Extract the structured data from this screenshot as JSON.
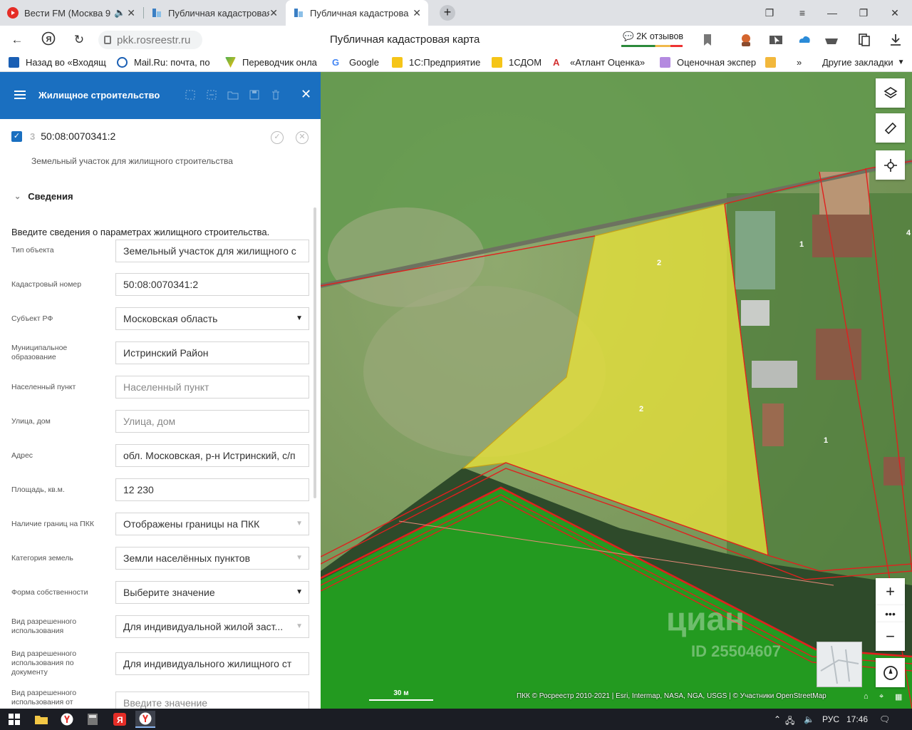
{
  "browser": {
    "tabs": [
      {
        "label": "Вести FM (Москва 9",
        "active": false
      },
      {
        "label": "Публичная кадастровая к",
        "active": false
      },
      {
        "label": "Публичная кадастрова",
        "active": true
      }
    ],
    "url": "pkk.rosreestr.ru",
    "page_title": "Публичная кадастровая карта",
    "reviews": "2K отзывов",
    "bookmarks": [
      "Назад во «Входящ",
      "Mail.Ru: почта, по",
      "Переводчик онла",
      "Google",
      "1С:Предприятие",
      "1СДОМ",
      "«Атлант Оценка»",
      "Оценочная экспер"
    ],
    "other_bookmarks": "Другие закладки"
  },
  "panel": {
    "title": "Жилищное строительство",
    "object_number": "3",
    "cadastral_number": "50:08:0070341:2",
    "object_subtitle": "Земельный участок для жилищного строительства",
    "section_title": "Сведения",
    "intro": "Введите сведения о параметрах жилищного строительства.",
    "fields": [
      {
        "label": "Тип объекта",
        "value": "Земельный участок для жилищного с",
        "kind": "text"
      },
      {
        "label": "Кадастровый номер",
        "value": "50:08:0070341:2",
        "kind": "text"
      },
      {
        "label": "Субъект РФ",
        "value": "Московская область",
        "kind": "select"
      },
      {
        "label": "Муниципальное образование",
        "value": "Истринский Район",
        "kind": "text"
      },
      {
        "label": "Населенный пункт",
        "placeholder": "Населенный пункт",
        "kind": "placeholder"
      },
      {
        "label": "Улица, дом",
        "placeholder": "Улица, дом",
        "kind": "placeholder"
      },
      {
        "label": "Адрес",
        "value": "обл. Московская, р-н Истринский, с/п",
        "kind": "text"
      },
      {
        "label": "Площадь, кв.м.",
        "value": "12 230",
        "kind": "text"
      },
      {
        "label": "Наличие границ на ПКК",
        "value": "Отображены границы на ПКК",
        "kind": "select-disabled"
      },
      {
        "label": "Категория земель",
        "value": "Земли населённых пунктов",
        "kind": "select-disabled"
      },
      {
        "label": "Форма собственности",
        "value": "Выберите значение",
        "kind": "select"
      },
      {
        "label": "Вид разрешенного использования",
        "value": "Для индивидуальной жилой заст...",
        "kind": "select-disabled"
      },
      {
        "label": "Вид разрешенного использования по документу",
        "value": "Для индивидуального жилищного ст",
        "kind": "text"
      },
      {
        "label": "Вид разрешенного использования от",
        "placeholder": "Введите значение",
        "kind": "placeholder"
      }
    ]
  },
  "map": {
    "parcel_labels": [
      "2",
      "2",
      "1",
      "1",
      "4"
    ],
    "scale": "30 м",
    "attribution": "ПКК © Росреестр 2010-2021 | Esri, Intermap, NASA, NGA, USGS | © Участники OpenStreetMap",
    "watermark": "циан",
    "watermark_id": "ID 25504607",
    "colors": {
      "selected_parcel": "#e8e23a",
      "forest_zone": "#22a51f",
      "boundary": "#e0201e"
    }
  },
  "taskbar": {
    "lang": "РУС",
    "time": "17:46"
  }
}
